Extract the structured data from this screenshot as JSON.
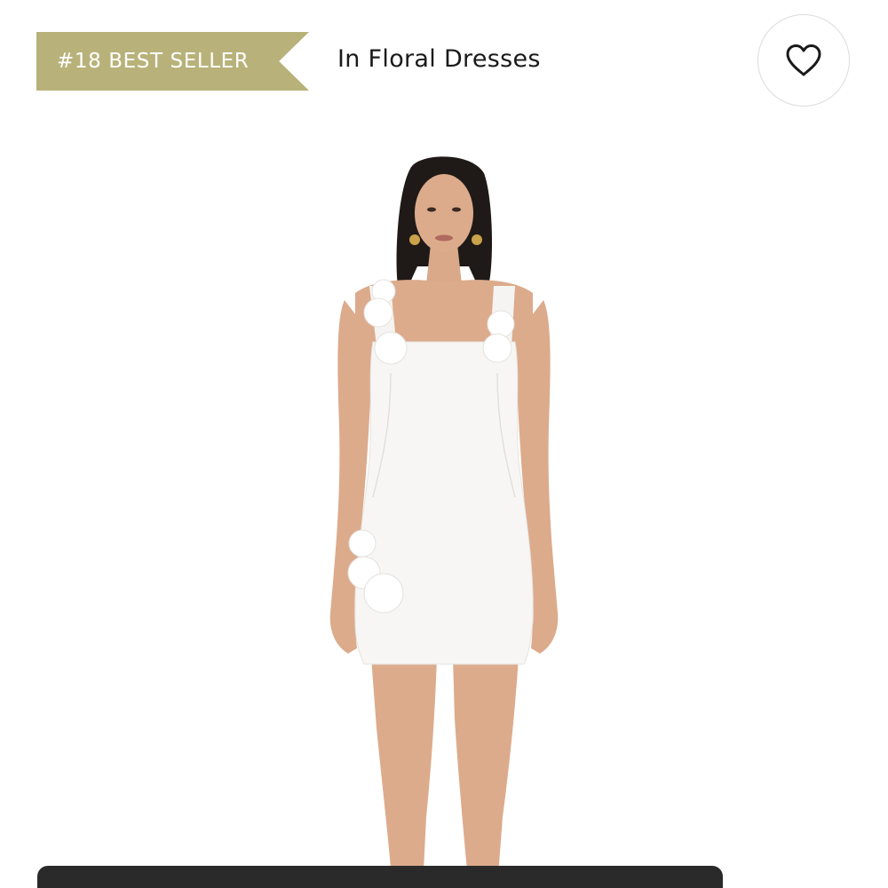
{
  "badge": {
    "rank_text": "#18 BEST SELLER",
    "color": "#b8b27a"
  },
  "category": {
    "label": "In Floral Dresses"
  },
  "wishlist": {
    "icon": "heart-icon"
  },
  "product": {
    "image_alt": "Model wearing white mini dress with floral appliqué straps"
  },
  "colors": {
    "text": "#1a1a1a",
    "bottom_bar": "#2a2a2a"
  }
}
